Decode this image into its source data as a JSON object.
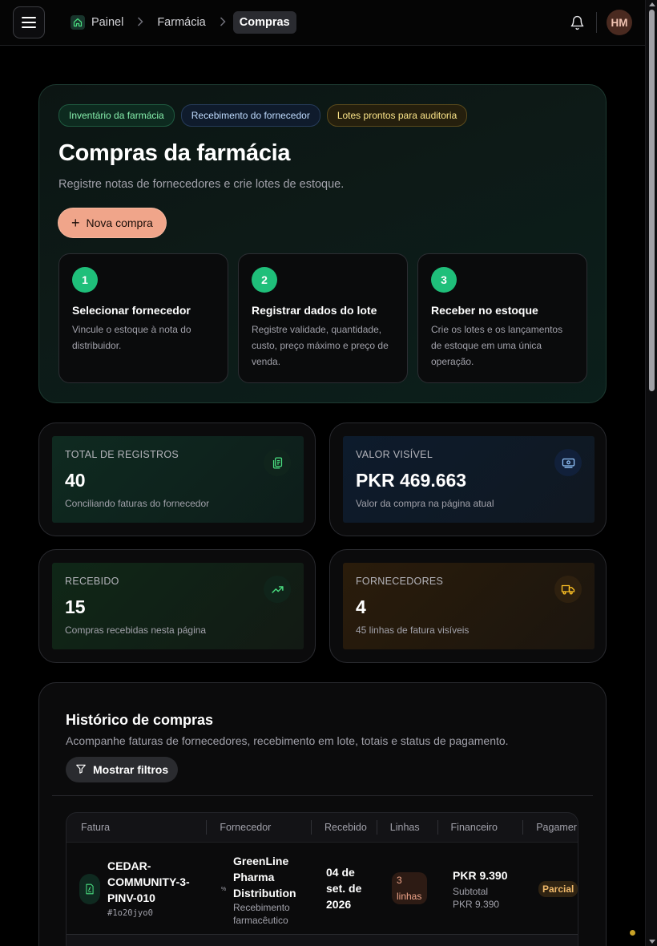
{
  "header": {
    "breadcrumb": [
      "Painel",
      "Farmácia",
      "Compras"
    ],
    "avatar_initials": "HM"
  },
  "hero": {
    "chips": [
      "Inventário da farmácia",
      "Recebimento do fornecedor",
      "Lotes prontos para auditoria"
    ],
    "title": "Compras da farmácia",
    "subtitle": "Registre notas de fornecedores e crie lotes de estoque.",
    "new_button": "Nova compra",
    "steps": [
      {
        "num": "1",
        "title": "Selecionar fornecedor",
        "text": "Vincule o estoque à nota do distribuidor."
      },
      {
        "num": "2",
        "title": "Registrar dados do lote",
        "text": "Registre validade, quantidade, custo, preço máximo e preço de venda."
      },
      {
        "num": "3",
        "title": "Receber no estoque",
        "text": "Crie os lotes e os lançamentos de estoque em uma única operação."
      }
    ]
  },
  "stats": [
    {
      "label": "TOTAL DE REGISTROS",
      "value": "40",
      "desc": "Conciliando faturas do fornecedor",
      "icon": "clipboard-copy-icon"
    },
    {
      "label": "VALOR VISÍVEL",
      "value": "PKR 469.663",
      "desc": "Valor da compra na página atual",
      "icon": "banknote-icon"
    },
    {
      "label": "RECEBIDO",
      "value": "15",
      "desc": "Compras recebidas nesta página",
      "icon": "trending-up-icon"
    },
    {
      "label": "FORNECEDORES",
      "value": "4",
      "desc": "45 linhas de fatura visíveis",
      "icon": "truck-icon"
    }
  ],
  "history": {
    "title": "Histórico de compras",
    "subtitle": "Acompanhe faturas de fornecedores, recebimento em lote, totais e status de pagamento.",
    "filter_button": "Mostrar filtros",
    "columns": [
      "Fatura",
      "Fornecedor",
      "Recebido",
      "Linhas",
      "Financeiro",
      "Pagamer"
    ],
    "rows": [
      {
        "invoice": "CEDAR-COMMUNITY-3-PINV-010",
        "code": "#1o20jyo0",
        "supplier": "GreenLine Pharma Distribution",
        "supplier_type": "Recebimento farmacêutico",
        "received": "04 de set. de 2026",
        "lines": "3 linhas",
        "total": "PKR 9.390",
        "subtotal_label": "Subtotal",
        "subtotal": "PKR 9.390",
        "payment": "Parcial"
      }
    ]
  }
}
